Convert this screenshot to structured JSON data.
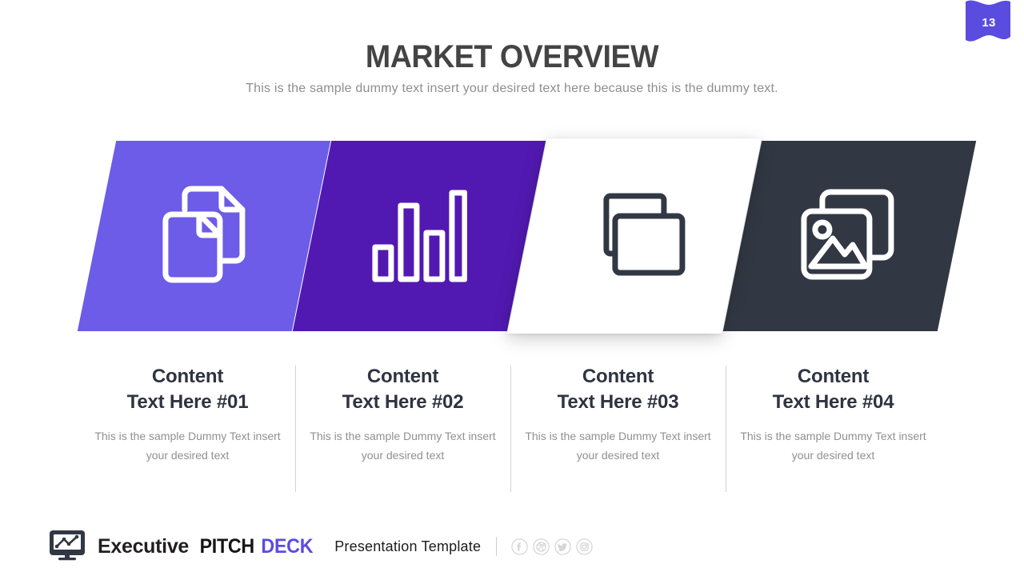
{
  "slide": {
    "page_number": "13",
    "title": "MARKET OVERVIEW",
    "subtitle": "This is the sample dummy text insert your desired text here because this is the dummy text."
  },
  "colors": {
    "card_1": "#6C5CE7",
    "card_2": "#5219B2",
    "card_3": "#FFFFFF",
    "card_4": "#323843",
    "badge": "#5B4CE0",
    "accent": "#5B4CE0",
    "title_text": "#444444",
    "subtitle_text": "#8E8E8E",
    "heading_text": "#2F3441",
    "body_text": "#909090",
    "divider": "#D3D3D3"
  },
  "cards": [
    {
      "icon": "copy-documents-icon",
      "background": "#6C5CE7",
      "icon_color": "#FFFFFF"
    },
    {
      "icon": "bar-chart-icon",
      "background": "#5219B2",
      "icon_color": "#FFFFFF"
    },
    {
      "icon": "copy-windows-icon",
      "background": "#FFFFFF",
      "icon_color": "#323843"
    },
    {
      "icon": "photo-gallery-icon",
      "background": "#323843",
      "icon_color": "#FFFFFF"
    }
  ],
  "columns": [
    {
      "title_line1": "Content",
      "title_line2": "Text Here #01",
      "description": "This is the sample Dummy Text insert your desired text"
    },
    {
      "title_line1": "Content",
      "title_line2": "Text Here #02",
      "description": "This is the sample Dummy Text insert your desired text"
    },
    {
      "title_line1": "Content",
      "title_line2": "Text Here #03",
      "description": "This is the sample Dummy Text insert your desired text"
    },
    {
      "title_line1": "Content",
      "title_line2": "Text Here #04",
      "description": "This is the sample Dummy Text insert your desired text"
    }
  ],
  "footer": {
    "logo_icon": "monitor-chart-icon",
    "brand_word_1": "Executive",
    "brand_word_2": "PITCH",
    "brand_word_3": "DECK",
    "tagline": "Presentation Template",
    "socials": [
      {
        "name": "facebook-icon",
        "glyph": "f"
      },
      {
        "name": "dribbble-icon",
        "glyph": "d"
      },
      {
        "name": "twitter-icon",
        "glyph": "t"
      },
      {
        "name": "instagram-icon",
        "glyph": "i"
      }
    ]
  }
}
